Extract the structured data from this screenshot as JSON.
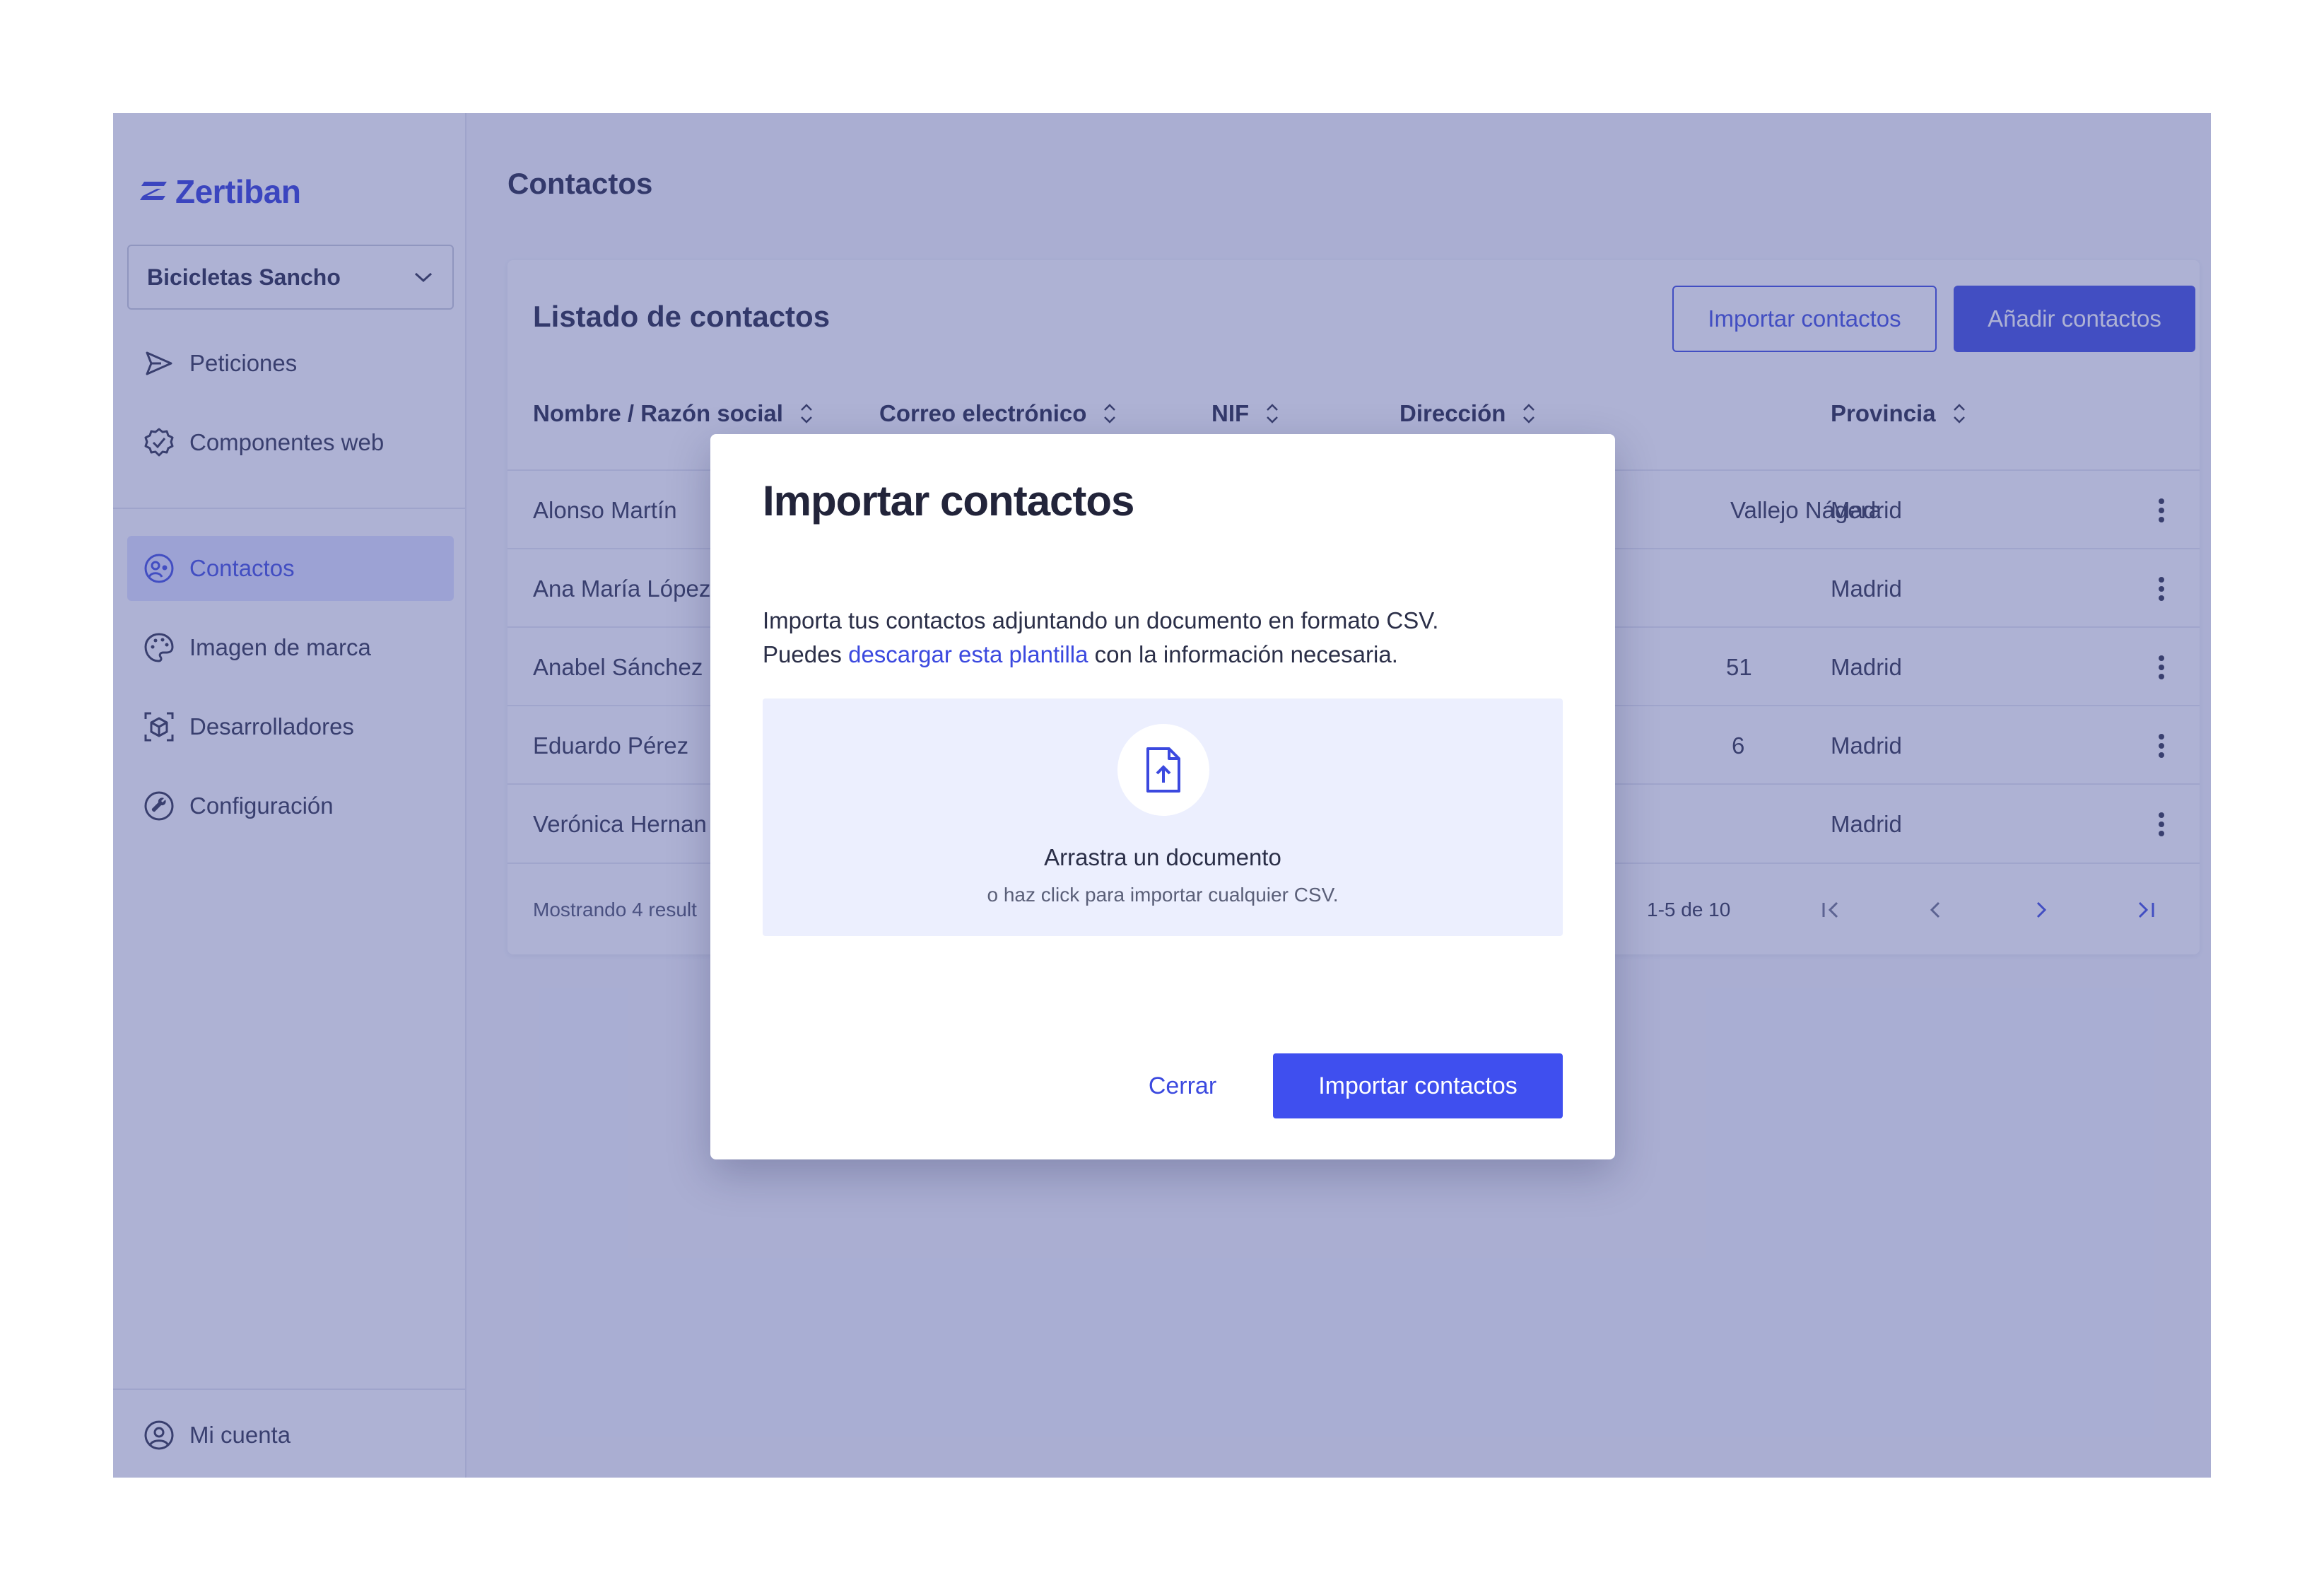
{
  "app": {
    "logo_text": "Zertiban",
    "brand_color": "#3b49df"
  },
  "sidebar": {
    "company": "Bicicletas Sancho",
    "items": [
      {
        "label": "Peticiones",
        "icon": "send-icon"
      },
      {
        "label": "Componentes web",
        "icon": "badge-check-icon"
      },
      {
        "label": "Contactos",
        "icon": "contacts-icon",
        "active": true
      },
      {
        "label": "Imagen de marca",
        "icon": "palette-icon"
      },
      {
        "label": "Desarrolladores",
        "icon": "cube-scan-icon"
      },
      {
        "label": "Configuración",
        "icon": "wrench-icon"
      }
    ],
    "account": {
      "label": "Mi cuenta",
      "icon": "user-circle-icon"
    }
  },
  "main": {
    "title": "Contactos",
    "card": {
      "title": "Listado de contactos",
      "import_button": "Importar contactos",
      "add_button": "Añadir contactos",
      "columns": [
        "Nombre / Razón social",
        "Correo electrónico",
        "NIF",
        "Dirección",
        "Provincia"
      ],
      "rows": [
        {
          "name": "Alonso Martín",
          "address_partial": "Vallejo Nágera",
          "province": "Madrid"
        },
        {
          "name": "Ana María López",
          "address_partial": "",
          "province": "Madrid"
        },
        {
          "name": "Anabel Sánchez",
          "address_partial": "51",
          "province": "Madrid"
        },
        {
          "name": "Eduardo Pérez",
          "address_partial": "6",
          "province": "Madrid"
        },
        {
          "name": "Verónica Hernan",
          "address_partial": "",
          "province": "Madrid"
        }
      ],
      "footer_text": "Mostrando 4 result",
      "page_range": "1-5 de 10"
    }
  },
  "modal": {
    "title": "Importar contactos",
    "desc_line1": "Importa tus contactos adjuntando un documento en formato CSV.",
    "desc_prefix": "Puedes ",
    "desc_link": "descargar esta plantilla",
    "desc_suffix": " con la información necesaria.",
    "dropzone_title": "Arrastra un documento",
    "dropzone_sub": "o haz click para importar cualquier CSV.",
    "close_button": "Cerrar",
    "import_button": "Importar contactos"
  }
}
